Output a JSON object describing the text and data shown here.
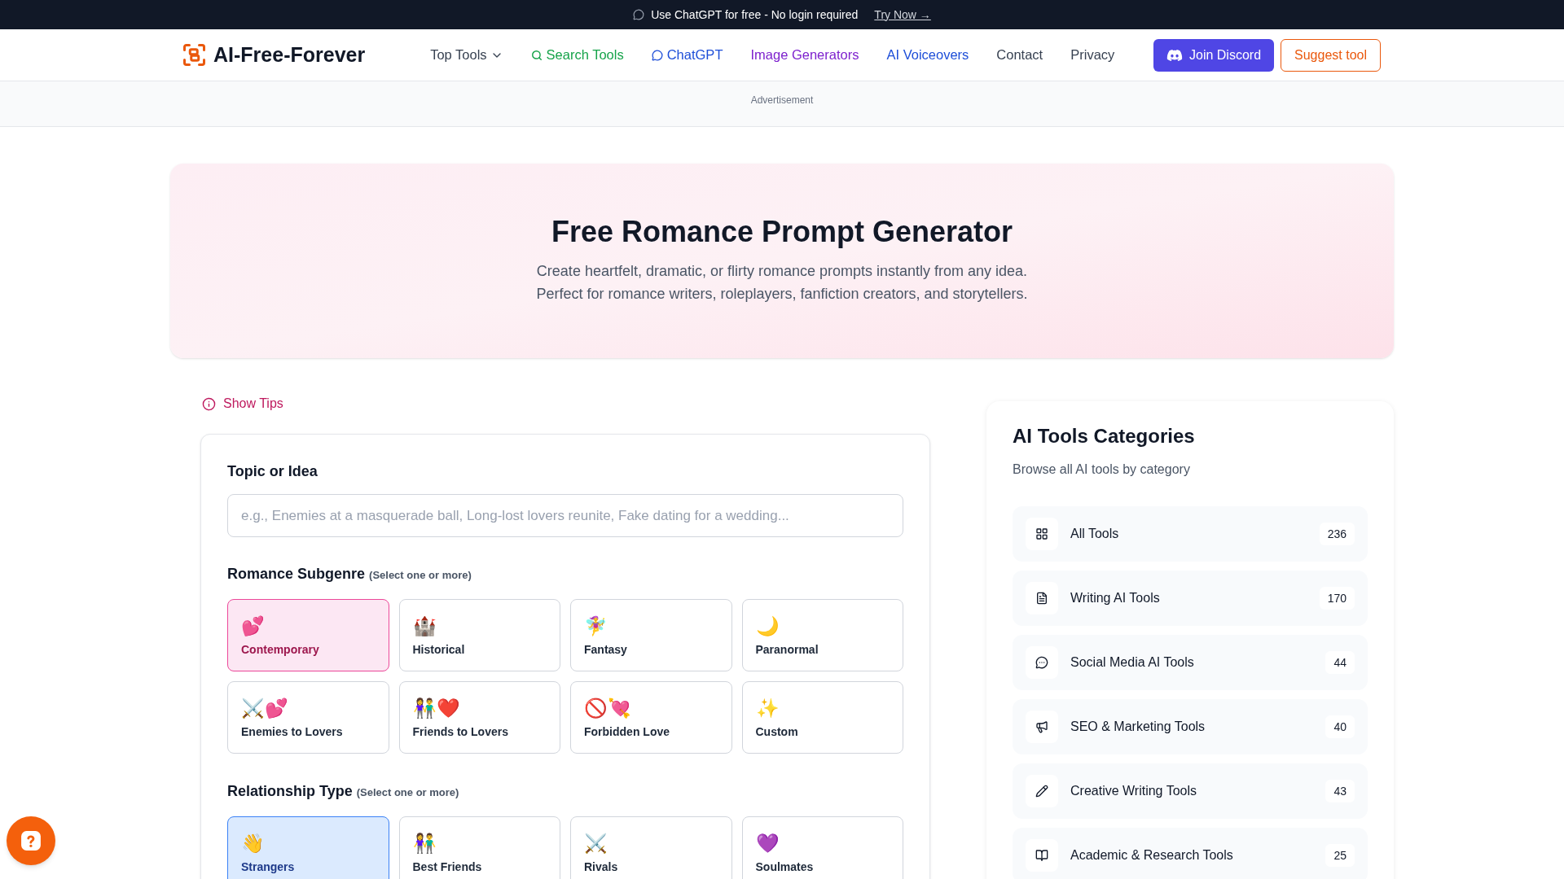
{
  "announcement": {
    "text": "Use ChatGPT for free - No login required",
    "link": "Try Now →"
  },
  "header": {
    "logo": "AI-Free-Forever",
    "nav": [
      {
        "label": "Top Tools",
        "kind": "dropdown",
        "color": "#374151"
      },
      {
        "label": "Search Tools",
        "kind": "search",
        "color": "#16a34a"
      },
      {
        "label": "ChatGPT",
        "kind": "chat",
        "color": "#1d4ed8"
      },
      {
        "label": "Image Generators",
        "kind": "plain",
        "color": "#7e22ce"
      },
      {
        "label": "AI Voiceovers",
        "kind": "plain",
        "color": "#1d4ed8"
      },
      {
        "label": "Contact",
        "kind": "plain",
        "color": "#374151"
      },
      {
        "label": "Privacy",
        "kind": "plain",
        "color": "#374151"
      }
    ],
    "buttons": [
      {
        "label": "Join Discord",
        "kind": "primary"
      },
      {
        "label": "Suggest tool",
        "kind": "outline"
      }
    ]
  },
  "ad": {
    "label": "Advertisement"
  },
  "hero": {
    "title": "Free Romance Prompt Generator",
    "lines": [
      "Create heartfelt, dramatic, or flirty romance prompts instantly from any idea.",
      "Perfect for romance writers, roleplayers, fanfiction creators, and storytellers."
    ]
  },
  "tips": {
    "label": "Show Tips"
  },
  "form": {
    "topic": {
      "label": "Topic or Idea",
      "placeholder": "e.g., Enemies at a masquerade ball, Long-lost lovers reunite, Fake dating for a wedding..."
    },
    "sections": [
      {
        "kind": "subgenre",
        "title": "Romance Subgenre",
        "hint": "(Select one or more)",
        "options": [
          {
            "emoji": "💕",
            "label": "Contemporary",
            "selected": true
          },
          {
            "emoji": "🏰",
            "label": "Historical",
            "selected": false
          },
          {
            "emoji": "🧚‍♀️",
            "label": "Fantasy",
            "selected": false
          },
          {
            "emoji": "🌙",
            "label": "Paranormal",
            "selected": false
          },
          {
            "emoji": "⚔️💕",
            "label": "Enemies to Lovers",
            "selected": false
          },
          {
            "emoji": "👫❤️",
            "label": "Friends to Lovers",
            "selected": false
          },
          {
            "emoji": "🚫💘",
            "label": "Forbidden Love",
            "selected": false
          },
          {
            "emoji": "✨",
            "label": "Custom",
            "selected": false
          }
        ]
      },
      {
        "kind": "relationship",
        "title": "Relationship Type",
        "hint": "(Select one or more)",
        "options": [
          {
            "emoji": "👋",
            "label": "Strangers",
            "selected": true
          },
          {
            "emoji": "👫",
            "label": "Best Friends",
            "selected": false
          },
          {
            "emoji": "⚔️",
            "label": "Rivals",
            "selected": false
          },
          {
            "emoji": "💜",
            "label": "Soulmates",
            "selected": false
          }
        ]
      }
    ]
  },
  "sidebar": {
    "title": "AI Tools Categories",
    "subtitle": "Browse all AI tools by category",
    "categories": [
      {
        "kind": "grid",
        "label": "All Tools",
        "count": "236"
      },
      {
        "kind": "document",
        "label": "Writing AI Tools",
        "count": "170"
      },
      {
        "kind": "chat",
        "label": "Social Media AI Tools",
        "count": "44"
      },
      {
        "kind": "megaphone",
        "label": "SEO & Marketing Tools",
        "count": "40"
      },
      {
        "kind": "pencil",
        "label": "Creative Writing Tools",
        "count": "43"
      },
      {
        "kind": "book",
        "label": "Academic & Research Tools",
        "count": "25"
      }
    ]
  }
}
